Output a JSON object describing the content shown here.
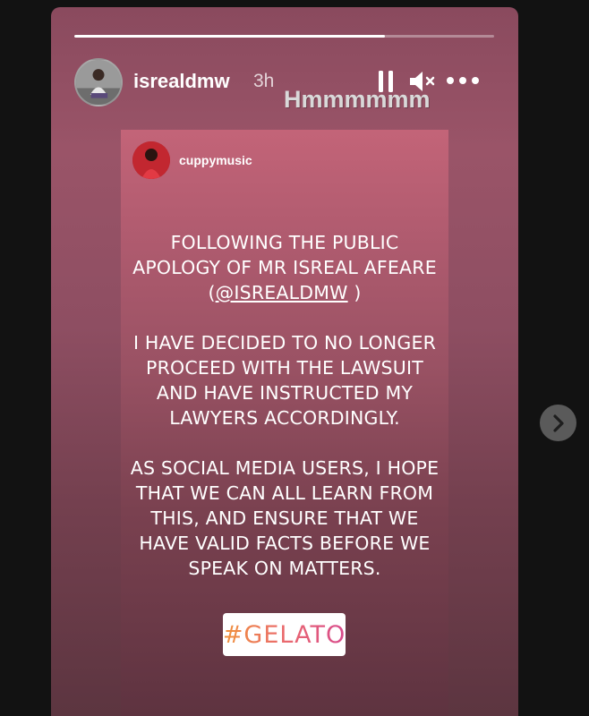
{
  "story": {
    "progress_fraction": 0.74,
    "username": "isrealdmw",
    "time": "3h",
    "caption": "Hmmmmmm",
    "controls": {
      "pause_icon": "pause-icon",
      "mute_icon": "muted-speaker-icon",
      "more_icon": "more-dots-icon"
    }
  },
  "repost": {
    "username": "cuppymusic",
    "lines_a": [
      "FOLLOWING THE PUBLIC",
      "APOLOGY OF MR ISREAL AFEARE",
      "(",
      "@ISREALDMW",
      " )"
    ],
    "lines_b": [
      "I HAVE DECIDED TO NO LONGER",
      "PROCEED WITH THE LAWSUIT",
      "AND HAVE INSTRUCTED MY",
      "LAWYERS ACCORDINGLY."
    ],
    "lines_c": [
      "AS SOCIAL MEDIA USERS, I HOPE",
      "THAT WE CAN ALL LEARN FROM",
      "THIS, AND ENSURE THAT WE",
      "HAVE VALID FACTS BEFORE WE",
      "SPEAK ON MATTERS."
    ],
    "sticker": "#GELATO"
  },
  "navigation": {
    "next_icon": "chevron-right-icon"
  },
  "colors": {
    "page_bg": "#121212",
    "story_bg": "#8a4a5e",
    "repost_bg": "#b05b6f",
    "sticker_gradient_start": "#f0923a",
    "sticker_gradient_end": "#d84a8c"
  }
}
